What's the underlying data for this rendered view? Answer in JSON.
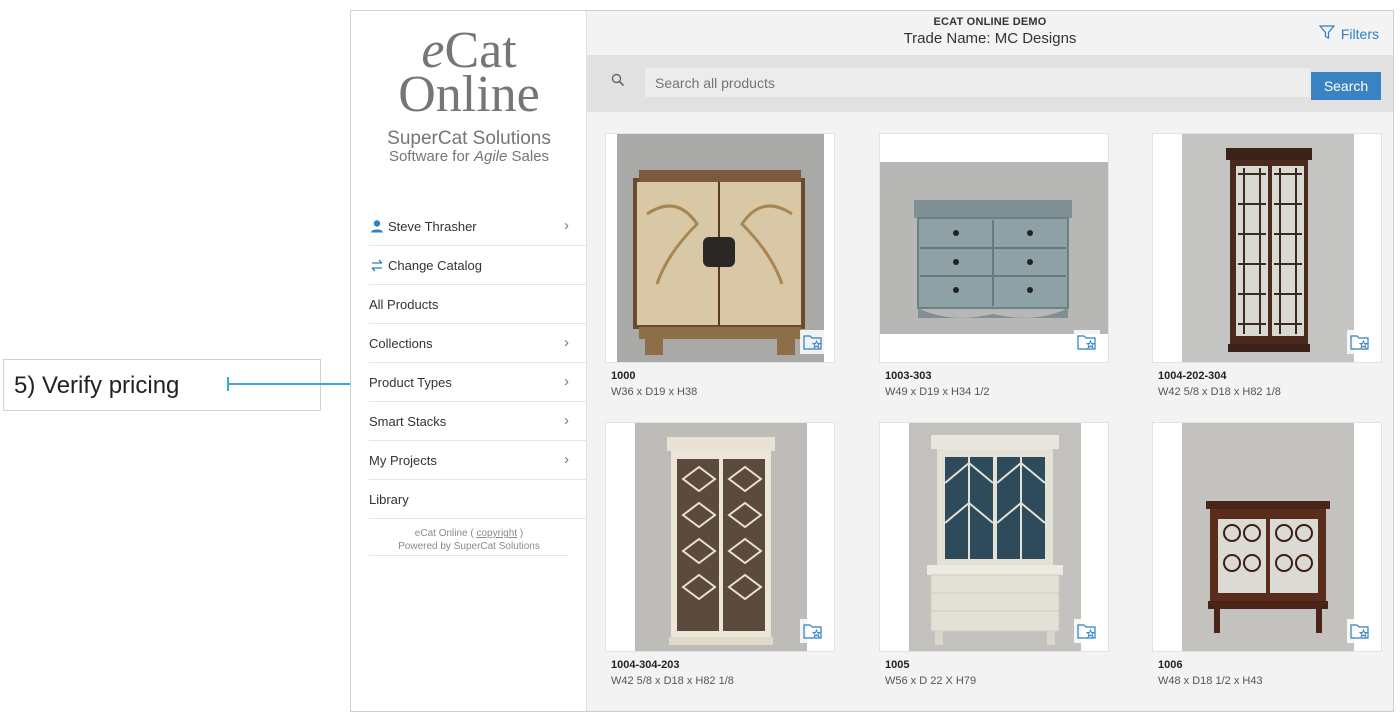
{
  "annotation": {
    "text": "5) Verify pricing"
  },
  "header": {
    "demo_label": "ECAT ONLINE DEMO",
    "trade_prefix": "Trade Name:",
    "trade_name": "MC Designs",
    "filters_label": "Filters"
  },
  "logo": {
    "word1_e": "e",
    "word1_rest": "Cat",
    "word2": "Online",
    "company": "SuperCat Solutions",
    "tagline_pre": "Software for",
    "tagline_em": "Agile",
    "tagline_post": "Sales"
  },
  "sidebar": {
    "items": [
      {
        "label": "Steve Thrasher",
        "icon": "user-icon",
        "chevron": true
      },
      {
        "label": "Change Catalog",
        "icon": "swap-icon",
        "chevron": false
      },
      {
        "label": "All Products",
        "chevron": false
      },
      {
        "label": "Collections",
        "chevron": true
      },
      {
        "label": "Product Types",
        "chevron": true
      },
      {
        "label": "Smart Stacks",
        "chevron": true
      },
      {
        "label": "My Projects",
        "chevron": true
      },
      {
        "label": "Library",
        "chevron": false
      }
    ],
    "footer_line1_pre": "eCat Online (",
    "footer_link": "copyright",
    "footer_line1_post": ")",
    "footer_line2": "Powered by SuperCat Solutions"
  },
  "search": {
    "placeholder": "Search all products",
    "button_label": "Search"
  },
  "products": [
    {
      "code": "1000",
      "dims": "W36 x D19 x H38"
    },
    {
      "code": "1003-303",
      "dims": "W49 x D19 x H34 1/2"
    },
    {
      "code": "1004-202-304",
      "dims": "W42 5/8 x D18 x H82 1/8"
    },
    {
      "code": "1004-304-203",
      "dims": "W42 5/8 x D18 x H82 1/8"
    },
    {
      "code": "1005",
      "dims": "W56 x D 22 X H79"
    },
    {
      "code": "1006",
      "dims": "W48 x D18 1/2 x H43"
    }
  ],
  "colors": {
    "accent": "#3a83c2",
    "annotation": "#3aa7d8"
  }
}
